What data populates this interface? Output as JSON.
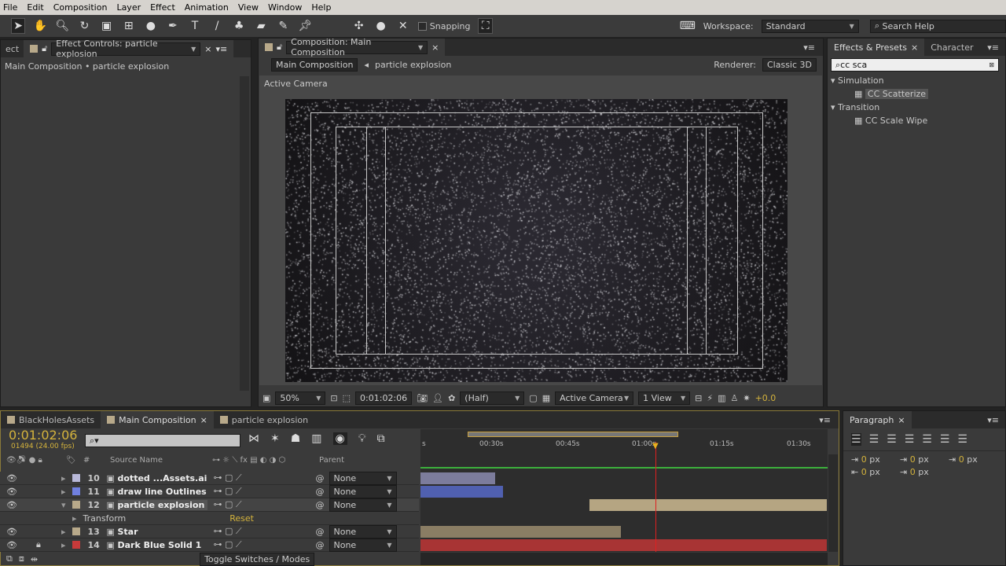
{
  "menu": [
    "File",
    "Edit",
    "Composition",
    "Layer",
    "Effect",
    "Animation",
    "View",
    "Window",
    "Help"
  ],
  "toolbar": {
    "snapping": "Snapping",
    "workspace_label": "Workspace:",
    "workspace": "Standard",
    "search_help": "Search Help"
  },
  "left_panel": {
    "partial_tab": "ect",
    "tab": "Effect Controls: particle explosion",
    "breadcrumb": "Main Composition • particle explosion"
  },
  "comp_panel": {
    "tab": "Composition: Main Composition",
    "crumb_active": "Main Composition",
    "crumb_next": "particle explosion",
    "renderer_label": "Renderer:",
    "renderer": "Classic 3D",
    "view_label": "Active Camera",
    "footer": {
      "zoom": "50%",
      "timecode": "0:01:02:06",
      "resolution": "(Half)",
      "camera": "Active Camera",
      "views": "1 View",
      "exposure": "+0.0"
    }
  },
  "effects_panel": {
    "tabs": [
      "Effects & Presets",
      "Character"
    ],
    "search": "cc sca",
    "groups": [
      {
        "name": "Simulation",
        "items": [
          "CC Scatterize"
        ]
      },
      {
        "name": "Transition",
        "items": [
          "CC Scale Wipe"
        ]
      }
    ]
  },
  "timeline": {
    "tabs": [
      "BlackHolesAssets",
      "Main Composition",
      "particle explosion"
    ],
    "timecode": "0:01:02:06",
    "frames": "01494 (24.00 fps)",
    "headers": {
      "num": "#",
      "source": "Source Name",
      "parent": "Parent"
    },
    "ruler": [
      "s",
      "00:30s",
      "00:45s",
      "01:00s",
      "01:15s",
      "01:30s"
    ],
    "layers": [
      {
        "num": "10",
        "name": "dotted ...Assets.ai",
        "color": "#b8b8d8",
        "parent": "None",
        "bar_color": "#7c7c9c"
      },
      {
        "num": "11",
        "name": "draw line Outlines",
        "color": "#7080e0",
        "parent": "None",
        "bar_color": "#5060b0"
      },
      {
        "num": "12",
        "name": "particle explosion",
        "color": "#b8a98a",
        "parent": "None",
        "bar_color": "#b5a582"
      },
      {
        "num": "13",
        "name": "Star",
        "color": "#b8a98a",
        "parent": "None",
        "bar_color": "#8a7d64"
      },
      {
        "num": "14",
        "name": "Dark Blue Solid 1",
        "color": "#c83a3a",
        "parent": "None",
        "bar_color": "#a83434"
      }
    ],
    "transform": "Transform",
    "reset": "Reset",
    "toggle": "Toggle Switches / Modes"
  },
  "paragraph": {
    "tab": "Paragraph",
    "values": [
      "0",
      "0",
      "0",
      "0",
      "0"
    ],
    "unit": "px"
  }
}
